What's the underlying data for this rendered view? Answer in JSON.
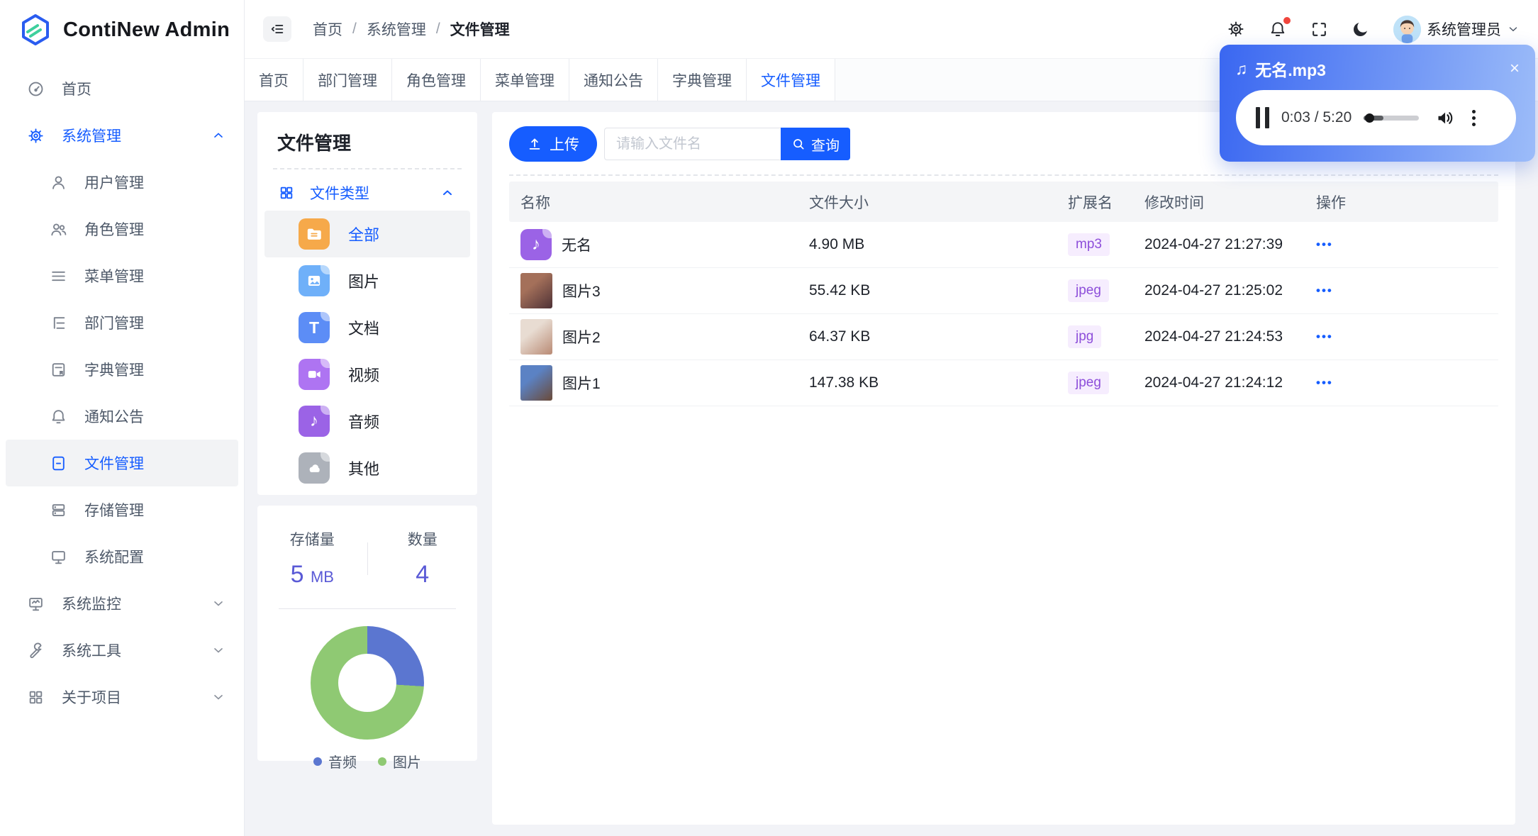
{
  "app": {
    "title": "ContiNew Admin"
  },
  "header": {
    "breadcrumb": [
      {
        "label": "首页"
      },
      {
        "label": "系统管理"
      },
      {
        "label": "文件管理"
      }
    ],
    "separator": "/",
    "user_name": "系统管理员"
  },
  "tabs": [
    {
      "label": "首页"
    },
    {
      "label": "部门管理"
    },
    {
      "label": "角色管理"
    },
    {
      "label": "菜单管理"
    },
    {
      "label": "通知公告"
    },
    {
      "label": "字典管理"
    },
    {
      "label": "文件管理",
      "active": true
    }
  ],
  "sidebar": {
    "items": [
      {
        "label": "首页"
      },
      {
        "label": "系统管理",
        "expanded": true,
        "children": [
          {
            "label": "用户管理"
          },
          {
            "label": "角色管理"
          },
          {
            "label": "菜单管理"
          },
          {
            "label": "部门管理"
          },
          {
            "label": "字典管理"
          },
          {
            "label": "通知公告"
          },
          {
            "label": "文件管理",
            "active": true
          },
          {
            "label": "存储管理"
          },
          {
            "label": "系统配置"
          }
        ]
      },
      {
        "label": "系统监控",
        "expanded": false
      },
      {
        "label": "系统工具",
        "expanded": false
      },
      {
        "label": "关于项目",
        "expanded": false
      }
    ]
  },
  "file_panel": {
    "title": "文件管理",
    "group_label": "文件类型",
    "types": [
      {
        "label": "全部",
        "color": "#F6A94A",
        "selected": true
      },
      {
        "label": "图片",
        "color": "#6FB0F9"
      },
      {
        "label": "文档",
        "color": "#5C8DF6"
      },
      {
        "label": "视频",
        "color": "#AE74F2"
      },
      {
        "label": "音频",
        "color": "#9B63E6"
      },
      {
        "label": "其他",
        "color": "#ADB2BA"
      }
    ]
  },
  "stats": {
    "storage_label": "存储量",
    "storage_value": "5",
    "storage_unit": "MB",
    "count_label": "数量",
    "count_value": "4"
  },
  "chart_data": {
    "type": "pie",
    "donut": true,
    "categories": [
      "音频",
      "图片"
    ],
    "values": [
      1,
      3
    ],
    "percentages": [
      26,
      74
    ],
    "colors": [
      "#5B76D0",
      "#8FC973"
    ],
    "legend_position": "bottom"
  },
  "toolbar": {
    "upload_label": "上传",
    "search_placeholder": "请输入文件名",
    "query_label": "查询"
  },
  "table": {
    "columns": [
      "名称",
      "文件大小",
      "扩展名",
      "修改时间",
      "操作"
    ],
    "action_more": "•••",
    "rows": [
      {
        "name": "无名",
        "kind": "audio",
        "size": "4.90 MB",
        "ext": "mp3",
        "time": "2024-04-27 21:27:39"
      },
      {
        "name": "图片3",
        "kind": "image",
        "size": "55.42 KB",
        "ext": "jpeg",
        "time": "2024-04-27 21:25:02",
        "thumb": {
          "c1": "#a4705a",
          "c2": "#4e3136"
        }
      },
      {
        "name": "图片2",
        "kind": "image",
        "size": "64.37 KB",
        "ext": "jpg",
        "time": "2024-04-27 21:24:53",
        "thumb": {
          "c1": "#e8dcd2",
          "c2": "#b98a74"
        }
      },
      {
        "name": "图片1",
        "kind": "image",
        "size": "147.38 KB",
        "ext": "jpeg",
        "time": "2024-04-27 21:24:12",
        "thumb": {
          "c1": "#5b82c4",
          "c2": "#6b4a38"
        }
      }
    ]
  },
  "audio_player": {
    "title": "无名.mp3",
    "note_glyph": "♫",
    "time": "0:03 / 5:20",
    "progress_pct": 36,
    "close_glyph": "×"
  },
  "colors": {
    "primary": "#165DFF",
    "ext_badge_bg": "#F6EDFE",
    "ext_badge_text": "#8D4EDA",
    "stat_value": "#5A5AD6"
  }
}
